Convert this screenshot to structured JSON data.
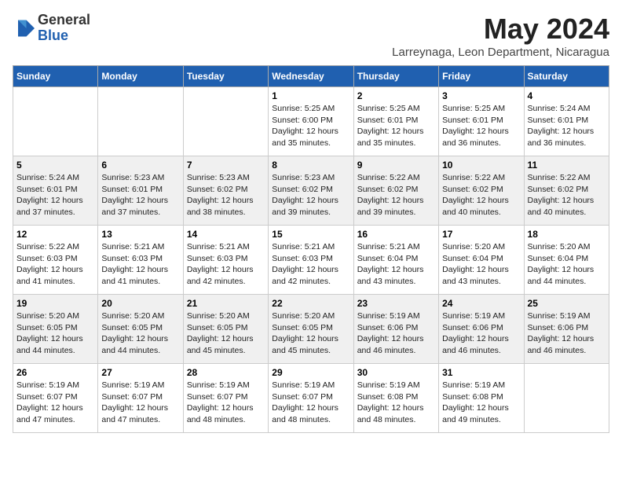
{
  "logo": {
    "general": "General",
    "blue": "Blue"
  },
  "title": {
    "month": "May 2024",
    "subtitle": "Larreynaga, Leon Department, Nicaragua"
  },
  "days_of_week": [
    "Sunday",
    "Monday",
    "Tuesday",
    "Wednesday",
    "Thursday",
    "Friday",
    "Saturday"
  ],
  "weeks": [
    [
      {
        "day": "",
        "info": ""
      },
      {
        "day": "",
        "info": ""
      },
      {
        "day": "",
        "info": ""
      },
      {
        "day": "1",
        "info": "Sunrise: 5:25 AM\nSunset: 6:00 PM\nDaylight: 12 hours\nand 35 minutes."
      },
      {
        "day": "2",
        "info": "Sunrise: 5:25 AM\nSunset: 6:01 PM\nDaylight: 12 hours\nand 35 minutes."
      },
      {
        "day": "3",
        "info": "Sunrise: 5:25 AM\nSunset: 6:01 PM\nDaylight: 12 hours\nand 36 minutes."
      },
      {
        "day": "4",
        "info": "Sunrise: 5:24 AM\nSunset: 6:01 PM\nDaylight: 12 hours\nand 36 minutes."
      }
    ],
    [
      {
        "day": "5",
        "info": "Sunrise: 5:24 AM\nSunset: 6:01 PM\nDaylight: 12 hours\nand 37 minutes."
      },
      {
        "day": "6",
        "info": "Sunrise: 5:23 AM\nSunset: 6:01 PM\nDaylight: 12 hours\nand 37 minutes."
      },
      {
        "day": "7",
        "info": "Sunrise: 5:23 AM\nSunset: 6:02 PM\nDaylight: 12 hours\nand 38 minutes."
      },
      {
        "day": "8",
        "info": "Sunrise: 5:23 AM\nSunset: 6:02 PM\nDaylight: 12 hours\nand 39 minutes."
      },
      {
        "day": "9",
        "info": "Sunrise: 5:22 AM\nSunset: 6:02 PM\nDaylight: 12 hours\nand 39 minutes."
      },
      {
        "day": "10",
        "info": "Sunrise: 5:22 AM\nSunset: 6:02 PM\nDaylight: 12 hours\nand 40 minutes."
      },
      {
        "day": "11",
        "info": "Sunrise: 5:22 AM\nSunset: 6:02 PM\nDaylight: 12 hours\nand 40 minutes."
      }
    ],
    [
      {
        "day": "12",
        "info": "Sunrise: 5:22 AM\nSunset: 6:03 PM\nDaylight: 12 hours\nand 41 minutes."
      },
      {
        "day": "13",
        "info": "Sunrise: 5:21 AM\nSunset: 6:03 PM\nDaylight: 12 hours\nand 41 minutes."
      },
      {
        "day": "14",
        "info": "Sunrise: 5:21 AM\nSunset: 6:03 PM\nDaylight: 12 hours\nand 42 minutes."
      },
      {
        "day": "15",
        "info": "Sunrise: 5:21 AM\nSunset: 6:03 PM\nDaylight: 12 hours\nand 42 minutes."
      },
      {
        "day": "16",
        "info": "Sunrise: 5:21 AM\nSunset: 6:04 PM\nDaylight: 12 hours\nand 43 minutes."
      },
      {
        "day": "17",
        "info": "Sunrise: 5:20 AM\nSunset: 6:04 PM\nDaylight: 12 hours\nand 43 minutes."
      },
      {
        "day": "18",
        "info": "Sunrise: 5:20 AM\nSunset: 6:04 PM\nDaylight: 12 hours\nand 44 minutes."
      }
    ],
    [
      {
        "day": "19",
        "info": "Sunrise: 5:20 AM\nSunset: 6:05 PM\nDaylight: 12 hours\nand 44 minutes."
      },
      {
        "day": "20",
        "info": "Sunrise: 5:20 AM\nSunset: 6:05 PM\nDaylight: 12 hours\nand 44 minutes."
      },
      {
        "day": "21",
        "info": "Sunrise: 5:20 AM\nSunset: 6:05 PM\nDaylight: 12 hours\nand 45 minutes."
      },
      {
        "day": "22",
        "info": "Sunrise: 5:20 AM\nSunset: 6:05 PM\nDaylight: 12 hours\nand 45 minutes."
      },
      {
        "day": "23",
        "info": "Sunrise: 5:19 AM\nSunset: 6:06 PM\nDaylight: 12 hours\nand 46 minutes."
      },
      {
        "day": "24",
        "info": "Sunrise: 5:19 AM\nSunset: 6:06 PM\nDaylight: 12 hours\nand 46 minutes."
      },
      {
        "day": "25",
        "info": "Sunrise: 5:19 AM\nSunset: 6:06 PM\nDaylight: 12 hours\nand 46 minutes."
      }
    ],
    [
      {
        "day": "26",
        "info": "Sunrise: 5:19 AM\nSunset: 6:07 PM\nDaylight: 12 hours\nand 47 minutes."
      },
      {
        "day": "27",
        "info": "Sunrise: 5:19 AM\nSunset: 6:07 PM\nDaylight: 12 hours\nand 47 minutes."
      },
      {
        "day": "28",
        "info": "Sunrise: 5:19 AM\nSunset: 6:07 PM\nDaylight: 12 hours\nand 48 minutes."
      },
      {
        "day": "29",
        "info": "Sunrise: 5:19 AM\nSunset: 6:07 PM\nDaylight: 12 hours\nand 48 minutes."
      },
      {
        "day": "30",
        "info": "Sunrise: 5:19 AM\nSunset: 6:08 PM\nDaylight: 12 hours\nand 48 minutes."
      },
      {
        "day": "31",
        "info": "Sunrise: 5:19 AM\nSunset: 6:08 PM\nDaylight: 12 hours\nand 49 minutes."
      },
      {
        "day": "",
        "info": ""
      }
    ]
  ]
}
